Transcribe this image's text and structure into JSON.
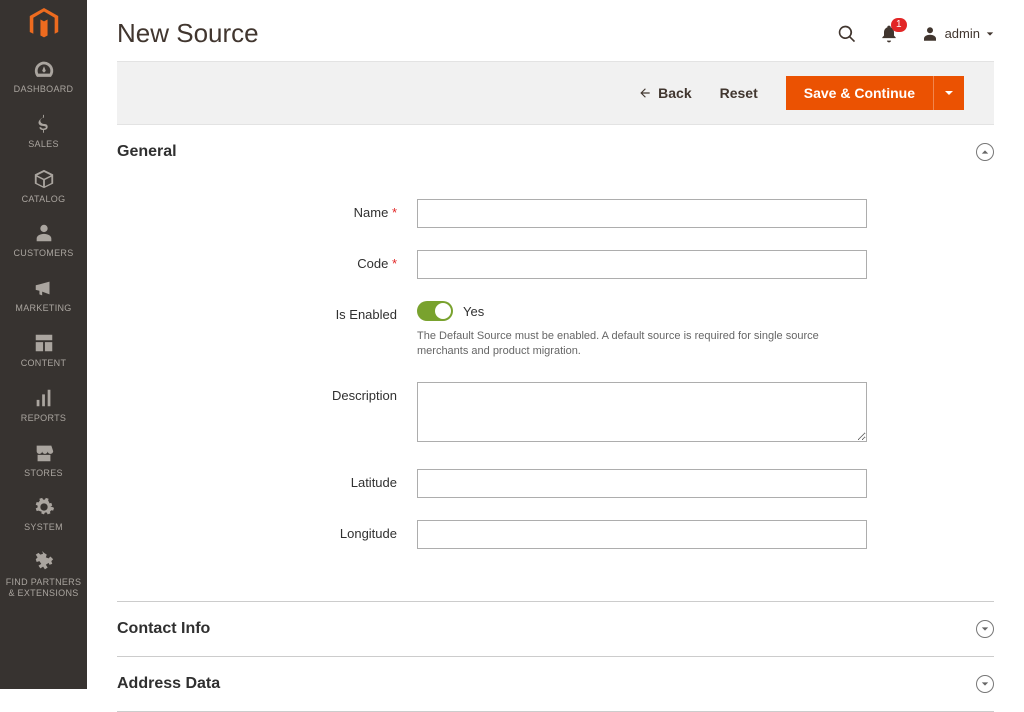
{
  "page_title": "New Source",
  "sidebar": {
    "items": [
      {
        "label": "Dashboard"
      },
      {
        "label": "Sales"
      },
      {
        "label": "Catalog"
      },
      {
        "label": "Customers"
      },
      {
        "label": "Marketing"
      },
      {
        "label": "Content"
      },
      {
        "label": "Reports"
      },
      {
        "label": "Stores"
      },
      {
        "label": "System"
      },
      {
        "label": "Find Partners & Extensions"
      }
    ]
  },
  "header": {
    "notification_count": "1",
    "username": "admin"
  },
  "action_bar": {
    "back": "Back",
    "reset": "Reset",
    "save": "Save & Continue"
  },
  "sections": {
    "general": {
      "title": "General",
      "fields": {
        "name_label": "Name",
        "name_value": "",
        "code_label": "Code",
        "code_value": "",
        "enabled_label": "Is Enabled",
        "enabled_value": "Yes",
        "enabled_note": "The Default Source must be enabled. A default source is required for single source merchants and product migration.",
        "description_label": "Description",
        "description_value": "",
        "latitude_label": "Latitude",
        "latitude_value": "",
        "longitude_label": "Longitude",
        "longitude_value": ""
      }
    },
    "contact": {
      "title": "Contact Info"
    },
    "address": {
      "title": "Address Data"
    }
  }
}
